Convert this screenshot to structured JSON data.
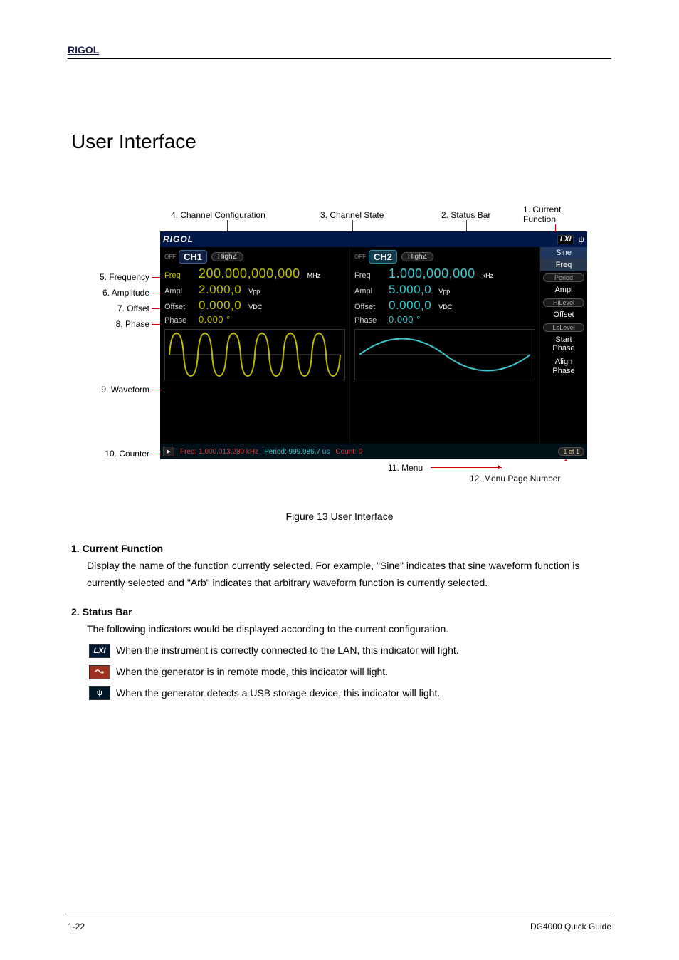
{
  "page_header": "RIGOL",
  "section_title": "User Interface",
  "figure": {
    "annotations": {
      "a1": "1. Current Function",
      "a2": "2. Status Bar",
      "a3": "3. Channel State",
      "a4": "4. Channel Configuration",
      "a5": "5. Frequency",
      "a6": "6. Amplitude",
      "a7": "7. Offset",
      "a8": "8. Phase",
      "a9": "9. Waveform",
      "a10": "10. Counter",
      "a11": "11. Menu",
      "a12": "12. Menu Page Number"
    },
    "screen": {
      "brand": "RIGOL",
      "lxi": "LXI",
      "usb_icon": "ψ",
      "menu_title": "Sine",
      "menu": {
        "freq": "Freq",
        "period": "Period",
        "ampl": "Ampl",
        "hilevel": "HiLevel",
        "offset": "Offset",
        "lolevel": "LoLevel",
        "start_phase": "Start\nPhase",
        "align_phase": "Align\nPhase"
      },
      "page_num": "1 of 1",
      "ch1": {
        "off": "OFF",
        "name": "CH1",
        "imp": "HighZ",
        "freq_label": "Freq",
        "freq_val": "200.000,000,000",
        "freq_unit": "MHz",
        "ampl_label": "Ampl",
        "ampl_val": "2.000,0",
        "ampl_unit": "Vpp",
        "offset_label": "Offset",
        "offset_val": "0.000,0",
        "offset_unit": "VDC",
        "phase_label": "Phase",
        "phase_val": "0.000 °"
      },
      "ch2": {
        "off": "OFF",
        "name": "CH2",
        "imp": "HighZ",
        "freq_label": "Freq",
        "freq_val": "1.000,000,000",
        "freq_unit": "kHz",
        "ampl_label": "Ampl",
        "ampl_val": "5.000,0",
        "ampl_unit": "Vpp",
        "offset_label": "Offset",
        "offset_val": "0.000,0",
        "offset_unit": "VDC",
        "phase_label": "Phase",
        "phase_val": "0.000 °"
      },
      "counter": {
        "play": "▶",
        "freq": "Freq: 1.000,013,280 kHz",
        "period": "Period: 999.986,7 us",
        "count": "Count: 0"
      }
    },
    "caption": "Figure 13 User Interface"
  },
  "legend": {
    "l1_title": "1. Current Function",
    "l1_body": "Display the name of the function currently selected. For example, \"Sine\" indicates that sine waveform function is currently selected and \"Arb\" indicates that arbitrary waveform function is currently selected.",
    "l2_title": "2. Status Bar",
    "l2_body": "The following indicators would be displayed according to the current configuration.",
    "lxi_label": "LXI",
    "lxi_text": "When the instrument is correctly connected to the LAN, this indicator will light.",
    "pxi_text": "When the generator is in remote mode, this indicator will light.",
    "usb_icon": "ψ",
    "usb_text": "When the generator detects a USB storage device, this indicator will light."
  },
  "footer": {
    "left": "1-22",
    "right": "DG4000 Quick Guide"
  }
}
